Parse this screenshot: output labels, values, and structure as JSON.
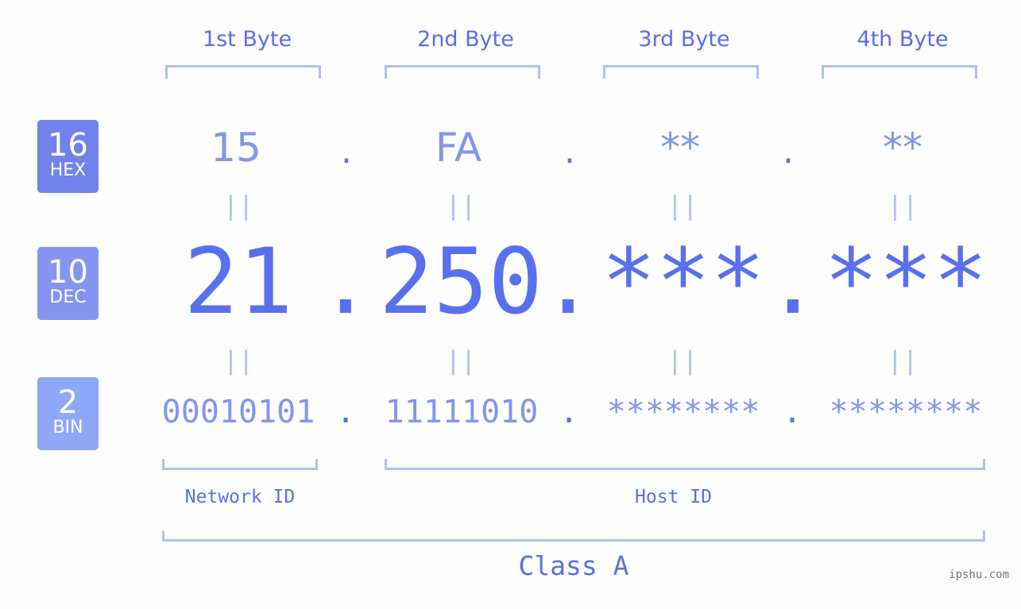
{
  "byte_headers": [
    "1st Byte",
    "2nd Byte",
    "3rd Byte",
    "4th Byte"
  ],
  "badges": {
    "hex": {
      "base": "16",
      "label": "HEX",
      "color": "#7182ea"
    },
    "dec": {
      "base": "10",
      "label": "DEC",
      "color": "#8595f2"
    },
    "bin": {
      "base": "2",
      "label": "BIN",
      "color": "#8fa7f8"
    }
  },
  "hex_values": [
    "15",
    "FA",
    "**",
    "**"
  ],
  "dec_values": [
    "21",
    "250",
    "***",
    "***"
  ],
  "bin_values": [
    "00010101",
    "11111010",
    "********",
    "********"
  ],
  "separator": ".",
  "equals": "||",
  "labels": {
    "network": "Network ID",
    "host": "Host ID",
    "class": "Class A"
  },
  "watermark": "ipshu.com"
}
